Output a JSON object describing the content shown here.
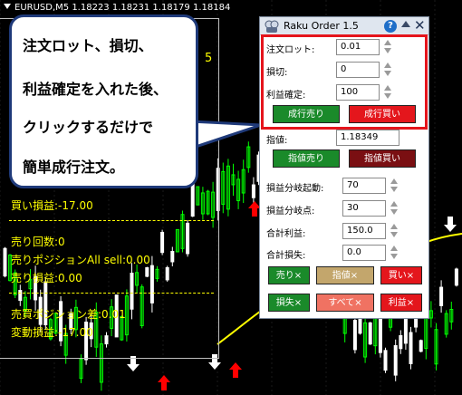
{
  "chart": {
    "symbol_timeframe": "EURUSD,M5",
    "open": "1.18223",
    "high": "1.18231",
    "low": "1.18179",
    "close": "1.18184",
    "background_color": "#000000",
    "bull_color": "#00ff00",
    "bear_color": "#ffffff",
    "ma_color": "#ffff00",
    "arrow_buy_color": "#ff0000",
    "arrow_sell_color": "#ffffff",
    "stray_digit": "5"
  },
  "info_panel": {
    "line_buy_pl": "買い損益:-17.00",
    "line_sell_count": "売り回数:0",
    "line_sell_position": "売りポジションAll sell:0.00",
    "line_sell_pl": "売り損益:0.00",
    "line_net_position": "売買ポジション差:0.01",
    "line_floating_pl": "変動損益:-17.00",
    "text_color": "#ffff00"
  },
  "callout": {
    "line1": "注文ロット、損切、",
    "line2": "利益確定を入れた後、",
    "line3": "クリックするだけで",
    "line4": "簡単成行注文。",
    "border_color": "#1f3a7a"
  },
  "order_panel": {
    "title": "Raku Order 1.5",
    "help_label": "?",
    "close_label": "✕",
    "lot_label": "注文ロット:",
    "lot_value": "0.01",
    "stop_loss_label": "損切:",
    "stop_loss_value": "0",
    "take_profit_label": "利益確定:",
    "take_profit_value": "100",
    "market_sell_label": "成行売り",
    "market_buy_label": "成行買い",
    "limit_price_label": "指値:",
    "limit_price_value": "1.18349",
    "limit_sell_label": "指値売り",
    "limit_buy_label": "指値買い",
    "breakeven_start_label": "損益分岐起動:",
    "breakeven_start_value": "70",
    "breakeven_point_label": "損益分岐点:",
    "breakeven_point_value": "30",
    "total_profit_label": "合計利益:",
    "total_profit_value": "150.0",
    "total_loss_label": "合計損失:",
    "total_loss_value": "0.0",
    "close_sell_label": "売り×",
    "close_limit_label": "指値×",
    "close_buy_label": "買い×",
    "close_loss_label": "損失×",
    "close_all_label": "すべて×",
    "close_profit_label": "利益×",
    "green": "#1a8a2a",
    "red": "#e4161c",
    "dark_red": "#7a0f12",
    "highlight_color": "#e5141c"
  }
}
